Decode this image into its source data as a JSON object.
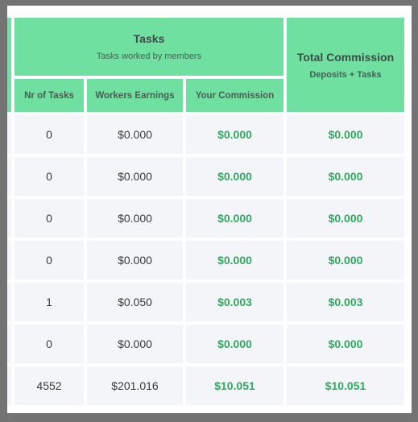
{
  "header": {
    "tasks_title": "Tasks",
    "tasks_subtitle": "Tasks worked by members",
    "total_title": "Total Commission",
    "total_subtitle": "Deposits + Tasks",
    "columns": [
      "Nr of Tasks",
      "Workers Earnings",
      "Your Commission"
    ]
  },
  "rows": [
    {
      "tasks": "0",
      "earnings": "$0.000",
      "commission": "$0.000",
      "total": "$0.000"
    },
    {
      "tasks": "0",
      "earnings": "$0.000",
      "commission": "$0.000",
      "total": "$0.000"
    },
    {
      "tasks": "0",
      "earnings": "$0.000",
      "commission": "$0.000",
      "total": "$0.000"
    },
    {
      "tasks": "0",
      "earnings": "$0.000",
      "commission": "$0.000",
      "total": "$0.000"
    },
    {
      "tasks": "1",
      "earnings": "$0.050",
      "commission": "$0.003",
      "total": "$0.003"
    },
    {
      "tasks": "0",
      "earnings": "$0.000",
      "commission": "$0.000",
      "total": "$0.000"
    },
    {
      "tasks": "4552",
      "earnings": "$201.016",
      "commission": "$10.051",
      "total": "$10.051"
    }
  ],
  "colors": {
    "header_bg": "#70e0a0",
    "cell_bg": "#f4f5f9",
    "accent_green": "#2eaa5e"
  }
}
